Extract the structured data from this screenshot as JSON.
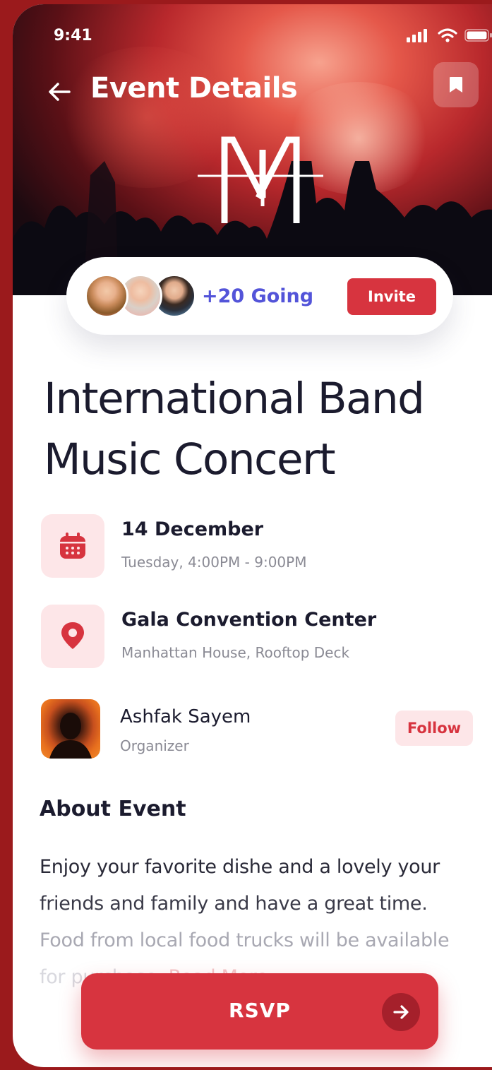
{
  "status_bar": {
    "time": "9:41"
  },
  "header": {
    "title": "Event Details"
  },
  "attendees": {
    "going_text": "+20 Going",
    "invite_label": "Invite"
  },
  "event": {
    "title_line1": "International Band",
    "title_line2": "Music Concert",
    "date": "14 December",
    "time": "Tuesday, 4:00PM - 9:00PM",
    "venue": "Gala Convention Center",
    "address": "Manhattan House, Rooftop Deck"
  },
  "organizer": {
    "name": "Ashfak Sayem",
    "role": "Organizer",
    "follow_label": "Follow"
  },
  "about": {
    "heading": "About Event",
    "line1": "Enjoy your favorite dishe and a lovely your",
    "line2": "friends and family and have a great time.",
    "line3": "Food from local food trucks will be available",
    "line4": "for purchase.",
    "read_more": "Read More..."
  },
  "cta": {
    "label": "RSVP"
  },
  "colors": {
    "accent": "#d7343f",
    "accent_soft": "#fde6e8",
    "going": "#5354d9",
    "background": "#9b1a1c"
  },
  "icons": [
    "back-arrow-icon",
    "bookmark-icon",
    "calendar-icon",
    "location-pin-icon",
    "arrow-right-icon",
    "signal-icon",
    "wifi-icon",
    "battery-icon"
  ]
}
